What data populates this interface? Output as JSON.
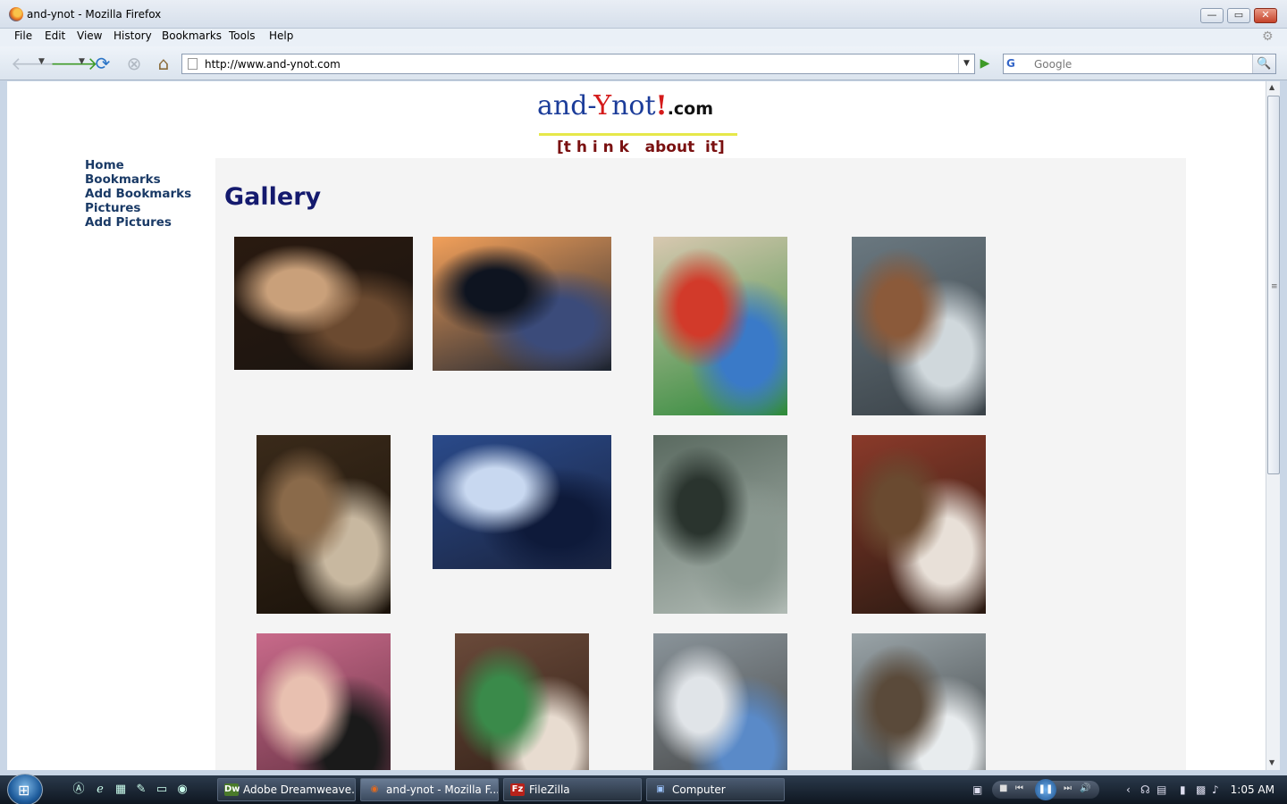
{
  "window": {
    "title": "and-ynot - Mozilla Firefox",
    "buttons": {
      "minimize": "—",
      "maximize": "▭",
      "close": "✕"
    }
  },
  "menubar": {
    "items": [
      "File",
      "Edit",
      "View",
      "History",
      "Bookmarks",
      "Tools",
      "Help"
    ]
  },
  "navbar": {
    "url": "http://www.and-ynot.com",
    "search_placeholder": "Google",
    "search_engine": "G"
  },
  "page": {
    "logo": {
      "brand_prefix": "and-",
      "brand_y": "Y",
      "brand_mid": "not",
      "brand_bang": "!",
      "brand_com": ".com",
      "tagline": "[t h i n k   about  it]"
    },
    "sidenav": [
      "Home",
      "Bookmarks",
      "Add Bookmarks",
      "Pictures",
      "Add Pictures"
    ],
    "heading": "Gallery",
    "gallery": [
      {
        "name": "photo-two-women-restaurant",
        "colors": [
          "#2a1a10",
          "#6b4a30",
          "#c9a07a",
          "#1a1410"
        ]
      },
      {
        "name": "photo-sunset-trees",
        "colors": [
          "#f2a05a",
          "#3b4b7a",
          "#0e1420",
          "#1b2330"
        ]
      },
      {
        "name": "photo-child-playroom",
        "colors": [
          "#d8c8b0",
          "#3a7ac8",
          "#d23a2a",
          "#2e8a3a"
        ]
      },
      {
        "name": "photo-snow-window",
        "colors": [
          "#6a7880",
          "#d0d8dc",
          "#8b5a3a",
          "#3a4248"
        ]
      },
      {
        "name": "photo-breakfast-tray",
        "colors": [
          "#3a2a1a",
          "#c8b8a0",
          "#8a6a4a",
          "#1a120a"
        ]
      },
      {
        "name": "photo-fountain-lake",
        "colors": [
          "#2a4a8a",
          "#0e1a3a",
          "#c8d8f0",
          "#1a2440"
        ]
      },
      {
        "name": "photo-airport-carts",
        "colors": [
          "#5a6a60",
          "#8a9890",
          "#2a342e",
          "#b0bab4"
        ]
      },
      {
        "name": "photo-boy-eating",
        "colors": [
          "#8a3a2a",
          "#e8e0d8",
          "#6a4a30",
          "#2a1a12"
        ]
      },
      {
        "name": "photo-baby-sunglasses",
        "colors": [
          "#c86a8a",
          "#1a1a1a",
          "#e8c0b0",
          "#5a2a3a"
        ]
      },
      {
        "name": "photo-baby-bottle",
        "colors": [
          "#6a4a3a",
          "#e8dcd0",
          "#3a8a4a",
          "#2a1a12"
        ]
      },
      {
        "name": "photo-woman-and-boy",
        "colors": [
          "#8a949a",
          "#5a8ac8",
          "#e0e4e8",
          "#3a3a3a"
        ]
      },
      {
        "name": "photo-snowy-building",
        "colors": [
          "#9aa4a8",
          "#e8ecee",
          "#5a4a3a",
          "#2a2e30"
        ]
      }
    ]
  },
  "taskbar": {
    "tasks": [
      {
        "label": "Adobe Dreamweave...",
        "icon": "Dw",
        "icon_color": "#4a7a2a"
      },
      {
        "label": "and-ynot - Mozilla F...",
        "icon": "🦊",
        "icon_color": "#e46a1e"
      },
      {
        "label": "FileZilla",
        "icon": "Fz",
        "icon_color": "#b8221a"
      },
      {
        "label": "Computer",
        "icon": "▣",
        "icon_color": "#4a78b8"
      }
    ],
    "clock": "1:05 AM"
  }
}
